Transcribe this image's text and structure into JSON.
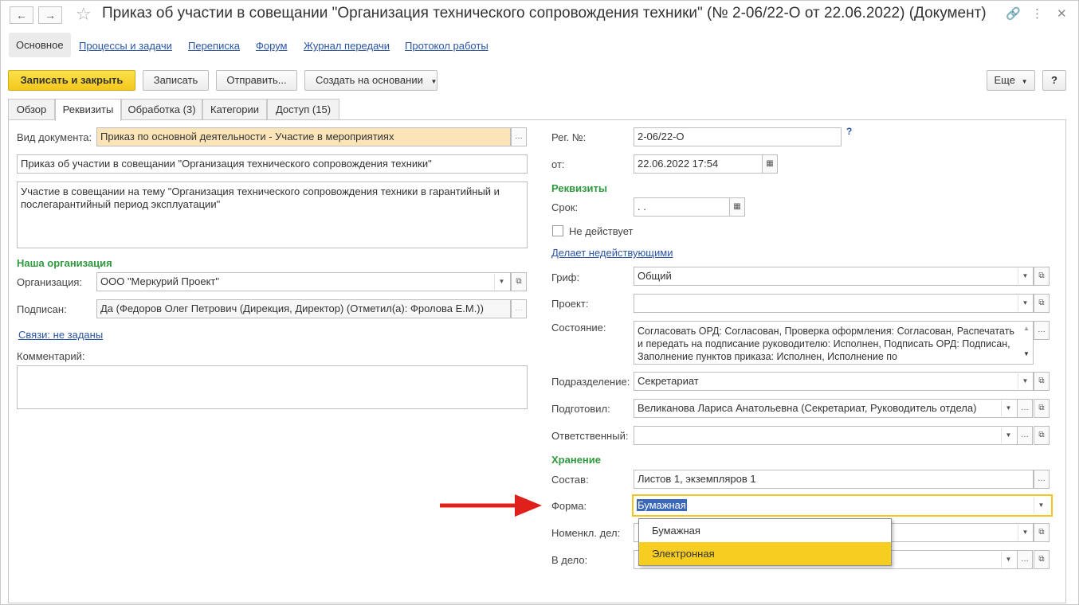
{
  "window": {
    "title": "Приказ об участии в совещании \"Организация технического сопровождения техники\" (№ 2-06/22-О от 22.06.2022) (Документ)"
  },
  "top_nav": {
    "tabs": [
      "Основное",
      "Процессы и задачи",
      "Переписка",
      "Форум",
      "Журнал передачи",
      "Протокол работы"
    ]
  },
  "toolbar": {
    "save_close": "Записать и закрыть",
    "save": "Записать",
    "send": "Отправить...",
    "create_based": "Создать на основании",
    "more": "Еще",
    "help": "?"
  },
  "tabs": [
    "Обзор",
    "Реквизиты",
    "Обработка (3)",
    "Категории",
    "Доступ (15)"
  ],
  "left": {
    "doc_type_label": "Вид документа:",
    "doc_type_value": "Приказ по основной деятельности - Участие в мероприятиях",
    "title_value": "Приказ об участии в совещании \"Организация технического сопровождения техники\"",
    "summary_value": "Участие в совещании на тему \"Организация технического сопровождения техники в гарантийный и послегарантийный период эксплуатации\"",
    "our_org_section": "Наша организация",
    "org_label": "Организация:",
    "org_value": "ООО \"Меркурий Проект\"",
    "signed_label": "Подписан:",
    "signed_value": "Да (Федоров Олег Петрович (Дирекция, Директор) (Отметил(а): Фролова Е.М.))",
    "links_label": "Связи: не заданы",
    "comment_label": "Комментарий:",
    "comment_value": ""
  },
  "right": {
    "reg_no_label": "Рег. №:",
    "reg_no_value": "2-06/22-О",
    "from_label": "от:",
    "from_value": "22.06.2022 17:54",
    "requisites_section": "Реквизиты",
    "deadline_label": "Срок:",
    "deadline_value": " .  .",
    "inactive_label": "Не действует",
    "makes_invalid_link": "Делает недействующими",
    "stamp_label": "Гриф:",
    "stamp_value": "Общий",
    "project_label": "Проект:",
    "project_value": "",
    "state_label": "Состояние:",
    "state_value": "Согласовать ОРД: Согласован, Проверка оформления: Согласован, Распечатать и передать на подписание руководителю: Исполнен, Подписать ОРД: Подписан, Заполнение пунктов приказа: Исполнен, Исполнение по",
    "dept_label": "Подразделение:",
    "dept_value": "Секретариат",
    "prepared_label": "Подготовил:",
    "prepared_value": "Великанова Лариса Анатольевна (Секретариат, Руководитель отдела)",
    "responsible_label": "Ответственный:",
    "responsible_value": "",
    "storage_section": "Хранение",
    "composition_label": "Состав:",
    "composition_value": "Листов 1, экземпляров 1",
    "form_label": "Форма:",
    "form_value": "Бумажная",
    "nomencl_label": "Номенкл. дел:",
    "to_case_label": "В дело:",
    "form_options": [
      "Бумажная",
      "Электронная"
    ]
  },
  "colors": {
    "accent_yellow": "#f3c71b",
    "section_green": "#2f9a3e",
    "link_blue": "#2a55a4",
    "arrow_red": "#e0201b"
  }
}
